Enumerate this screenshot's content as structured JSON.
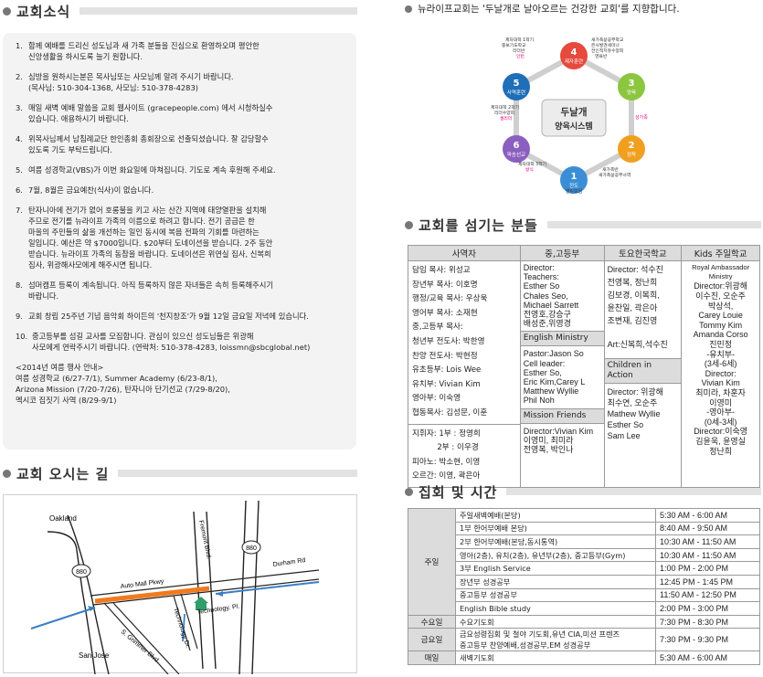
{
  "news": {
    "title": "교회소식",
    "items": [
      {
        "num": "1.",
        "text": "함께 예배를 드리신 성도님과 새 가족 분들을 진심으로 환영하오며 평안한\n신앙생활을 하시도록 늘기 원합니다."
      },
      {
        "num": "2.",
        "text": "심방을 원하시는분은 목사님또는 사모님께 알려 주시기 바랍니다.\n(목사님: 510-304-1368, 사모님: 510-378-4283)"
      },
      {
        "num": "3.",
        "text": "매일 새벽 예배 말씀을 교회 웹사이트 (gracepeople.com) 에서 시청하실수\n있습니다. 애용하시기 바랍니다."
      },
      {
        "num": "4.",
        "text": "위목사님께서 남침례교단 한인총회 총회장으로 선출되셨습니다. 잘 감당할수\n있도록 기도 부탁드립니다."
      },
      {
        "num": "5.",
        "text": "여름 성경학교(VBS)가 이번 화요일에 마쳐집니다. 기도로 계속 후원해 주세요."
      },
      {
        "num": "6.",
        "text": "7월, 8월은 금요예찬(식사)이 없습니다."
      },
      {
        "num": "7.",
        "text": "탄자니아에 전기가 없어 호롱불을 키고 사는 산간 지역에 태양열판을 설치해\n주므로 전기를 뉴라이프 가족의 이름으로 하려고 합니다. 전기 공급은 한\n마을의 주민들의 삶을 개선하는 일인 동시에 복음 전파의 기회를 마련하는\n일입니다. 예산은 약 $7000입니다. $20부터 도네이션을 받습니다. 2주 동안\n받습니다. 뉴라이프 가족의 동참을 바랍니다. 도네이션은 위연실 집사, 신복희\n집사, 위광해사모에게 해주시면 됩니다."
      },
      {
        "num": "8.",
        "text": "섬머캠프 등록이 계속됩니다. 아직 등록하지 않은 자녀들은 속히 등록해주시기\n바랍니다."
      },
      {
        "num": "9.",
        "text": "교회 창립 25주년 기념 음악회 하이든의 '천지창조'가 9월 12일 금요일 저녁에 있습니다."
      },
      {
        "num": "10.",
        "text": "중고등부를 섬길 교사를 모집합니다. 관심이 있으신 성도님들은 위광해\n사모에게 연락주시기 바랍니다. (연락처: 510-378-4283, loissmn@sbcglobal.net)"
      }
    ],
    "summer": "<2014년 여름 행사 안내>\n  여름 성경학교 (6/27-7/1), Summer Academy (6/23-8/1),\n  Arizona Mission (7/20-7/26), 탄자니아 단기선교 (7/29-8/20),\n  멕시코 집짓기 사역 (8/29-9/1)"
  },
  "map": {
    "title": "교회 오시는 길",
    "labels": {
      "oakland": "Oakland",
      "san_jose": "San Jose",
      "i880_left": "880",
      "i880_right": "880",
      "fremont": "Fremont Blvd.",
      "auto_mall": "Auto Mall Pkwy",
      "durham": "Durham Rd",
      "technology_dr": "Technology Dr.",
      "technology_pl": "Technology. Pl.",
      "grimmer": "S. Grimmer Blvd."
    },
    "colors": {
      "route": "#f07a1e",
      "arrow": "#3b7fc4",
      "church": "#2e9e6b"
    }
  },
  "motto": "뉴라이프교회는 '두날개로 날아오르는 건강한 교회'를 지향합니다.",
  "diagram": {
    "center_title": "두날개",
    "center_subtitle": "양육시스템",
    "nodes": [
      {
        "num": "1",
        "label": "전도",
        "color": "#3b8ed6"
      },
      {
        "num": "2",
        "label": "정착",
        "color": "#f0a020"
      },
      {
        "num": "3",
        "label": "양육",
        "color": "#8cc63f"
      },
      {
        "num": "4",
        "label": "제자훈련",
        "color": "#e64a3c"
      },
      {
        "num": "5",
        "label": "사역훈련",
        "color": "#1e6eb8"
      },
      {
        "num": "6",
        "label": "파송선교",
        "color": "#8b5fbf"
      }
    ],
    "notes": {
      "top_left": "제자대학 1학기\n중보기도학교\n리더반\n인턴",
      "top_right": "새가족삶공부학교\n은사발견세미나\n전인적치유수양회\n영육반",
      "left": "제자대학 2학기\n리더수양회\n셀리더",
      "right": "성가족",
      "bottom_left": "제자대학 3학기\n방식",
      "bottom_right": "새가족반\n새가족삶공부사역",
      "bottom": "열린모임"
    },
    "colors": {
      "pink": "#e6007e",
      "green": "#5aa02c",
      "orange": "#f07a1e"
    }
  },
  "staff": {
    "title": "교회를 섬기는 분들",
    "headers": [
      "사역자",
      "중,고등부",
      "토요한국학교",
      "Kids 주일학교"
    ],
    "col1": [
      "담임 목사: 위성교",
      "장년부 목사: 이호명",
      "행정/교육 목사: 우상욱",
      "영어부 목사: 소재현",
      "중,고등부 목사:",
      "청년부 전도사: 박한영",
      "찬양 전도사: 박현정",
      "유초등부: Lois Wee",
      "유치부: Vivian Kim",
      "영아부: 이숙영",
      "협동목사: 김성문, 이훈"
    ],
    "col1_bottom": [
      "지휘자: 1부 : 정영희",
      "          2부 : 이우경",
      "피아노: 박소현, 이영",
      "오르간: 이영, 곽은아"
    ],
    "col2": {
      "director": "Director:",
      "teachers": "Teachers:\nEsther So\nChales Seo,\nMichael Sarrett\n전영호,강승구\n배성준,위영경",
      "english_head": "English Ministry",
      "english": "Pastor:Jason So\nCell leader:\nEsther So,\nEric Kim,Carey L\nMatthew Wyllie\nPhil Noh",
      "mission_head": "Mission Friends",
      "mission": "Director:Vivian Kim\n이영미, 최미라\n전영복, 박인나"
    },
    "col3": {
      "director": "Director: 석수진\n전영복, 정난희\n김보경, 이복희,\n윤찬일, 곽은아\n조변재, 김진영",
      "art": "Art:신복희,석수진",
      "children_head": "Children in Action",
      "children": "Director: 위광해\n최수연, 오순주\nMathew Wyllie\nEsther So\nSam Lee"
    },
    "col4": {
      "royal": "Royal Ambassador\nMinistry",
      "royal_list": "Director:위광해\n이수진, 오순주\n박상석,\nCarey Louie\nTommy Kim\nAmanda Corso\n진민정\n-유치부-\n(3세-6세)\nDirector:\nVivian Kim\n최미라, 차훈자\n이영미\n-영아부-\n(0세-3세)\nDirector:이숙영\n김윤욱, 윤영실\n정난희"
    }
  },
  "schedule": {
    "title": "집회 및 시간",
    "groups": [
      {
        "day": "주일",
        "rows": [
          {
            "name": "주일새벽예배(본당)",
            "time": "5:30 AM - 6:00 AM"
          },
          {
            "name": "1부 한어부예배 본당)",
            "time": "8:40 AM - 9:50 AM"
          },
          {
            "name": "2부 한어부예배(본당,동시통역)",
            "time": "10:30 AM - 11:50 AM"
          },
          {
            "name": "영아(2층), 유치(2층), 유년부(2층), 중고등부(Gym)",
            "time": "10:30 AM - 11:50 AM"
          },
          {
            "name": "3부 English Service",
            "time": "1:00 PM - 2:00 PM"
          },
          {
            "name": "장년부 성경공부",
            "time": "12:45 PM - 1:45 PM"
          },
          {
            "name": "중고등부 성경공부",
            "time": "11:50 AM - 12:50 PM"
          },
          {
            "name": "English Bible study",
            "time": "2:00 PM -  3:00 PM"
          }
        ]
      },
      {
        "day": "수요일",
        "rows": [
          {
            "name": "수요기도회",
            "time": "7:30 PM - 8:30 PM"
          }
        ]
      },
      {
        "day": "금요일",
        "rows": [
          {
            "name": "금요성령집회 및 철야 기도회,유년 CIA,미션 프렌즈\n중고등부 찬양예배,성경공부,EM 성경공부",
            "time": "7:30 PM - 9:30 PM"
          }
        ]
      },
      {
        "day": "매일",
        "rows": [
          {
            "name": "새벽기도회",
            "time": "5:30 AM - 6:00 AM"
          }
        ]
      }
    ]
  }
}
